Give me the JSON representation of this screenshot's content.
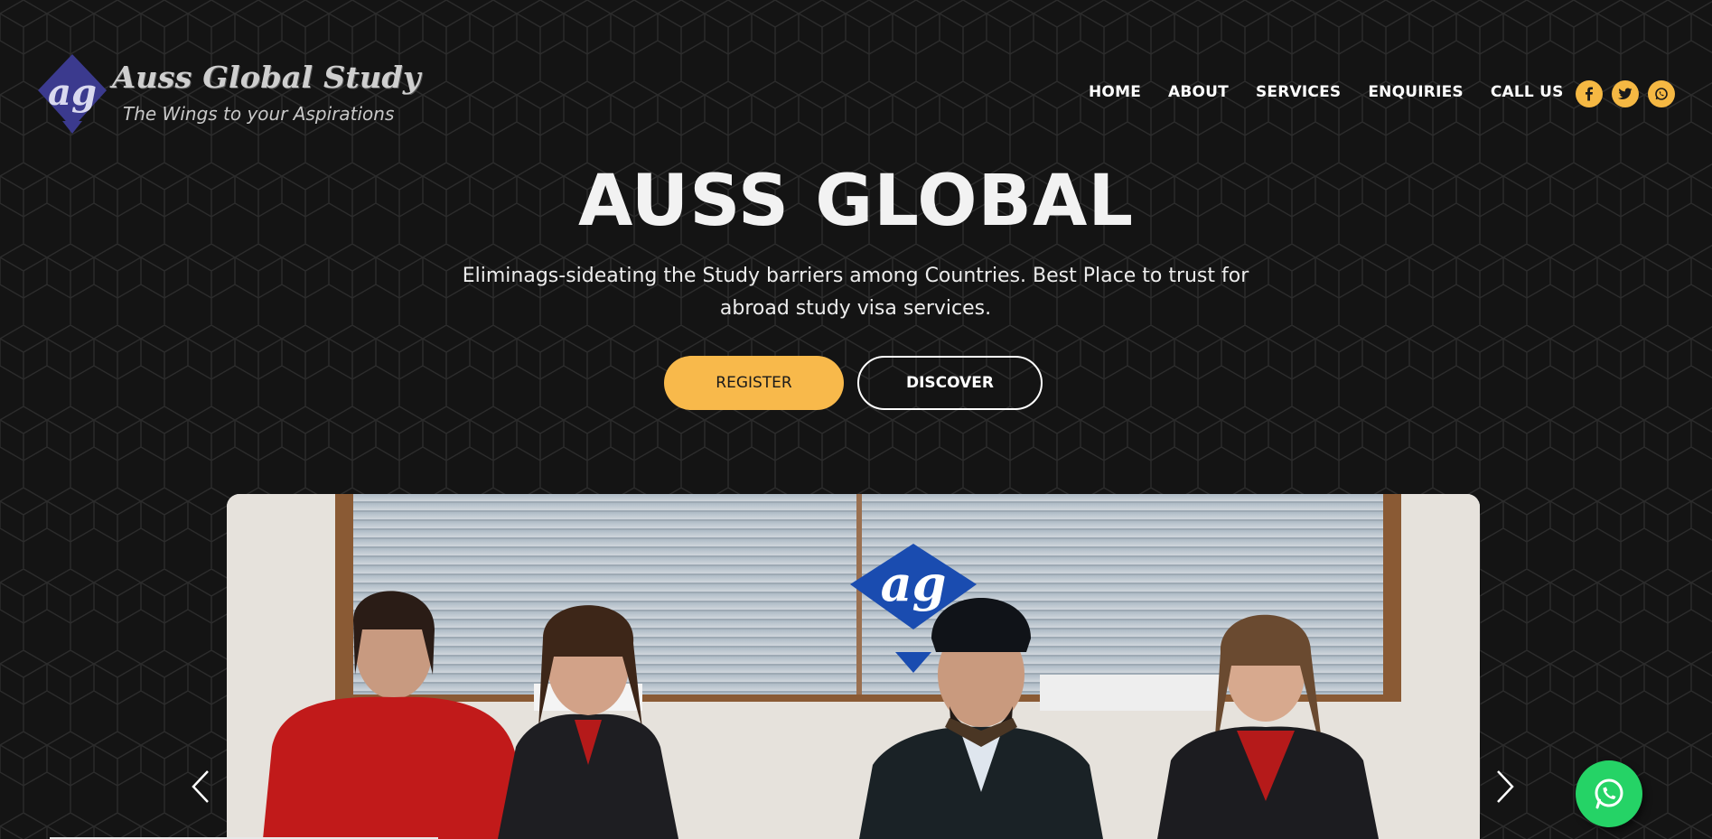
{
  "brand": {
    "name": "Auss Global Study",
    "tagline": "The Wings to your Aspirations"
  },
  "nav": {
    "items": [
      "HOME",
      "ABOUT",
      "SERVICES",
      "ENQUIRIES",
      "CALL US"
    ]
  },
  "social": [
    "facebook-icon",
    "twitter-icon",
    "whatsapp-icon"
  ],
  "hero": {
    "title": "AUSS GLOBAL",
    "subtitle_line1": "Eliminags-sideating the Study barriers among Countries. Best Place to trust for",
    "subtitle_line2": "abroad study visa services.",
    "register_label": "REGISTER",
    "discover_label": "DISCOVER"
  },
  "carousel": {
    "slide_image": "team-photo",
    "prev_icon": "chevron-left-icon",
    "next_icon": "chevron-right-icon"
  },
  "float_button": "whatsapp-chat-icon",
  "colors": {
    "background": "#141414",
    "accent": "#f8b94b",
    "whatsapp": "#25d366",
    "text": "#ffffff"
  }
}
